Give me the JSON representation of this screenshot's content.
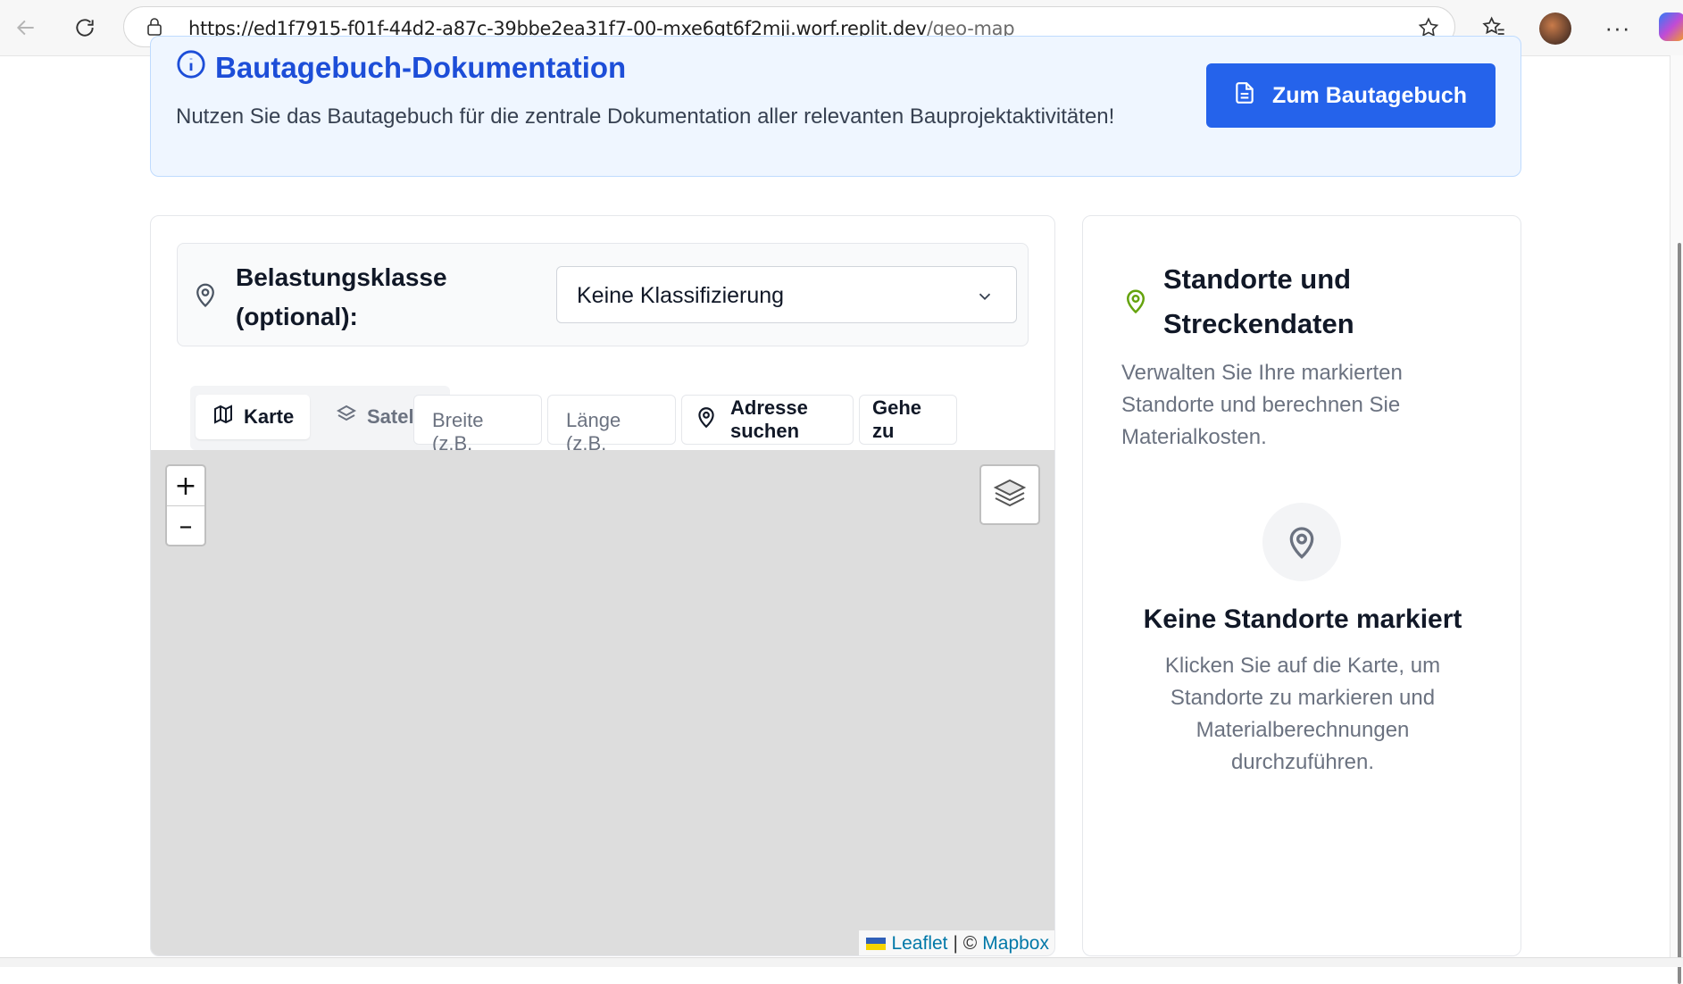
{
  "browser": {
    "url_host": "https://ed1f7915-f01f-44d2-a87c-39bbe2ea31f7-00-mxe6gt6f2mji.worf.replit.dev",
    "url_path": "/geo-map"
  },
  "banner": {
    "title": "Bautagebuch-Dokumentation",
    "text": "Nutzen Sie das Bautagebuch für die zentrale Dokumentation aller relevanten Bauprojektaktivitäten!",
    "button_label": "Zum Bautagebuch"
  },
  "classification": {
    "label": "Belastungsklasse (optional):",
    "selected": "Keine Klassifizierung"
  },
  "toolbar": {
    "map_tab": "Karte",
    "satellite_tab": "Satellit",
    "lat_placeholder": "Breite (z.B.",
    "lng_placeholder": "Länge (z.B.",
    "address_button": "Adresse suchen",
    "goto_button": "Gehe zu"
  },
  "map": {
    "zoom_in": "+",
    "zoom_out": "–",
    "attribution_leaflet": "Leaflet",
    "attribution_sep": "| ©",
    "attribution_mapbox": "Mapbox"
  },
  "locations_panel": {
    "title": "Standorte und Streckendaten",
    "description": "Verwalten Sie Ihre markierten Standorte und berechnen Sie Materialkosten.",
    "empty_title": "Keine Standorte markiert",
    "empty_text": "Klicken Sie auf die Karte, um Standorte zu markieren und Materialberechnungen durchzuführen."
  },
  "colors": {
    "primary": "#2563eb",
    "banner_bg": "#eff6ff",
    "map_bg": "#dddddd",
    "location_icon": "#65a30d"
  }
}
